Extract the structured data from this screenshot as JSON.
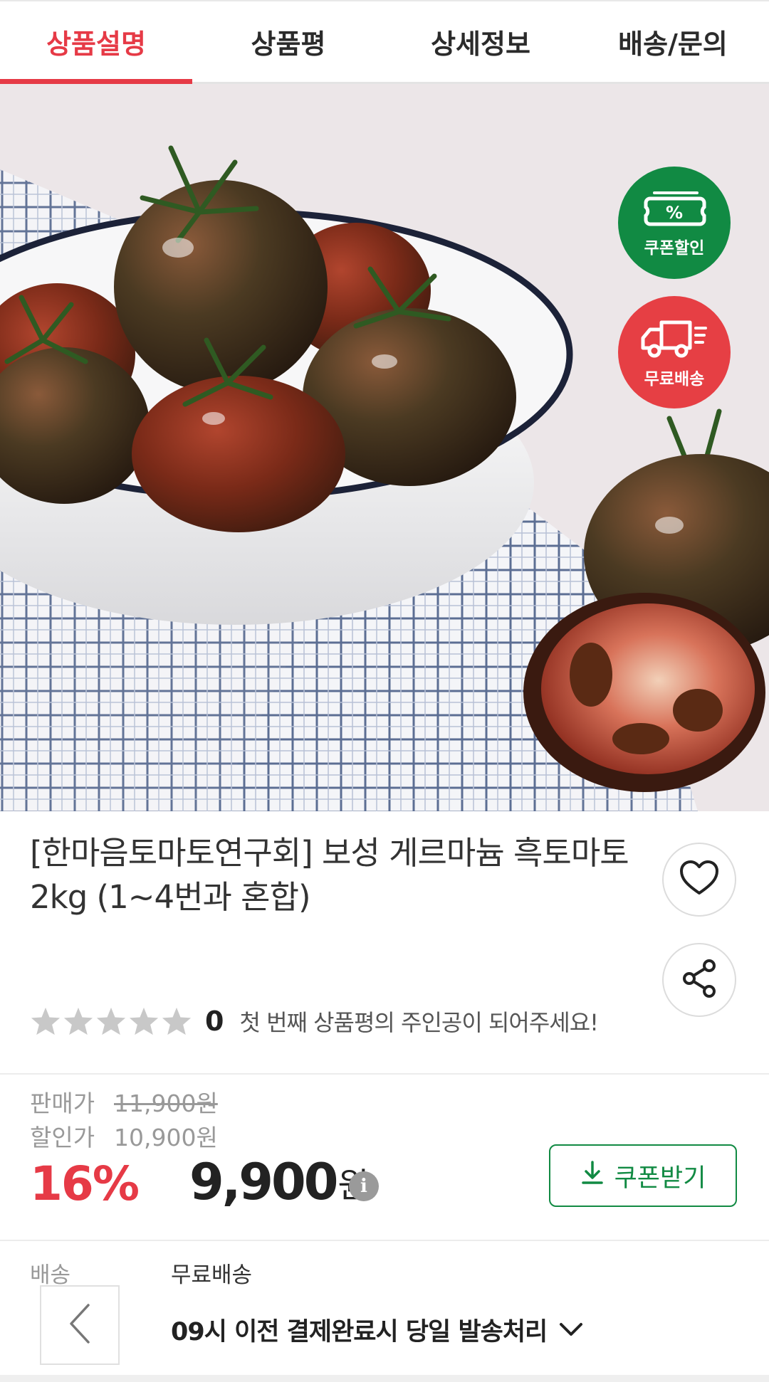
{
  "tabs": [
    {
      "label": "상품설명",
      "active": true
    },
    {
      "label": "상품평",
      "active": false
    },
    {
      "label": "상세정보",
      "active": false
    },
    {
      "label": "배송/문의",
      "active": false
    }
  ],
  "badges": {
    "coupon": {
      "label": "쿠폰할인",
      "icon": "coupon-ticket-icon",
      "symbol": "%",
      "color": "#118a43"
    },
    "delivery": {
      "label": "무료배송",
      "icon": "delivery-truck-icon",
      "color": "#e63f44"
    }
  },
  "product": {
    "title": "[한마음토마토연구회] 보성 게르마늄 흑토마토 2kg (1~4번과 혼합)",
    "rating": {
      "stars": 0,
      "max_stars": 5,
      "count": "0",
      "message": "첫 번째 상품평의 주인공이 되어주세요!"
    }
  },
  "price": {
    "sale_label": "판매가",
    "sale_value": "11,900원",
    "discount_label": "할인가",
    "discount_value": "10,900원",
    "rate": "16%",
    "final_value": "9,900",
    "final_unit": "원",
    "info_symbol": "i",
    "coupon_button": "쿠폰받기"
  },
  "shipping": {
    "label": "배송",
    "value": "무료배송",
    "detail": "09시 이전 결제완료시 당일 발송처리"
  },
  "colors": {
    "accent": "#e63a46",
    "green": "#118a43"
  }
}
